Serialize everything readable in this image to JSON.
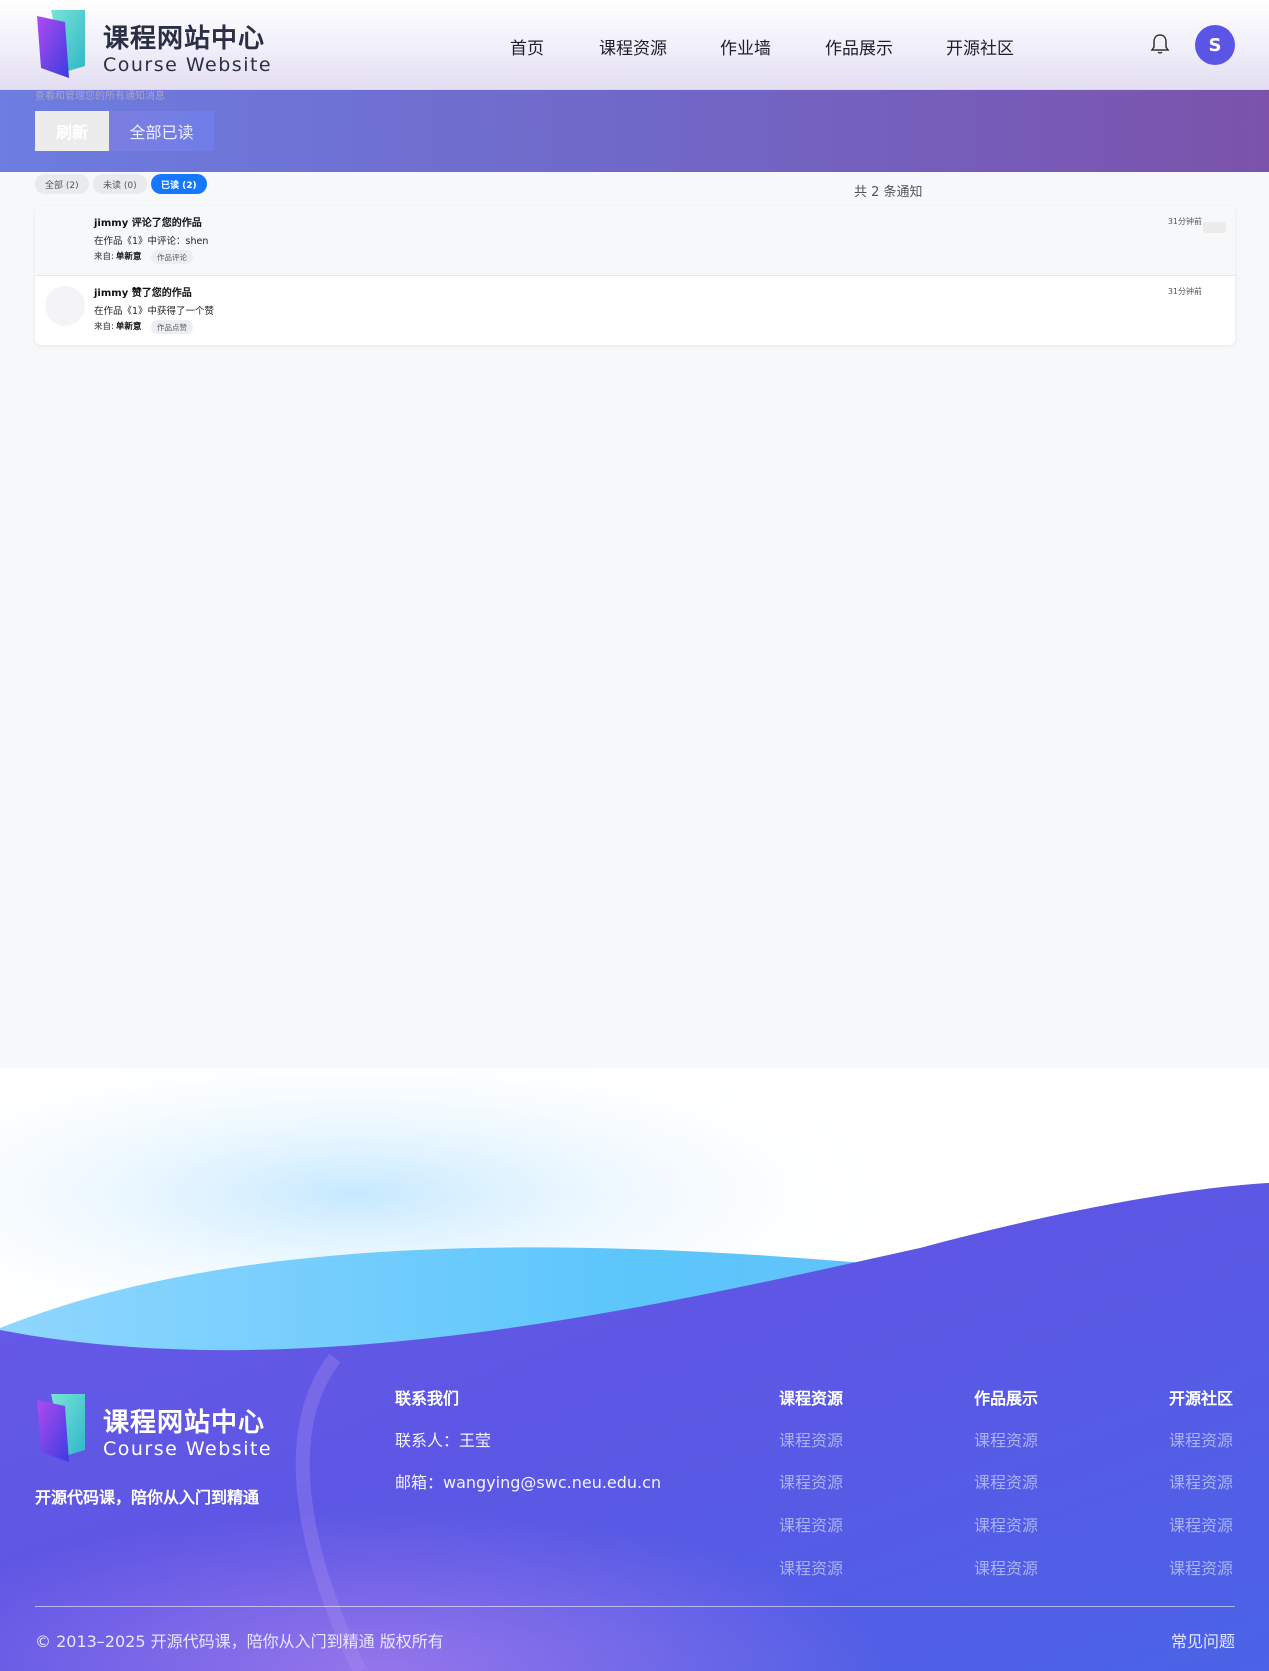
{
  "colors": {
    "accent": "#5b55e6",
    "primary_blue": "#1677ff",
    "banner_start": "#6d7de0",
    "banner_end": "#7b53ab",
    "footer_blue": "#4a63e7"
  },
  "brand": {
    "name_cn": "课程网站中心",
    "name_en": "Course Website",
    "logo_icon": "book-logo-icon"
  },
  "nav": {
    "items": [
      {
        "label": "首页"
      },
      {
        "label": "课程资源"
      },
      {
        "label": "作业墙"
      },
      {
        "label": "作品展示"
      },
      {
        "label": "开源社区"
      }
    ],
    "bell_icon": "bell-icon",
    "avatar_letter": "S"
  },
  "banner": {
    "subtitle": "查看和管理您的所有通知消息",
    "refresh_label": "刷新",
    "read_all_label": "全部已读"
  },
  "filters": {
    "all": "全部 (2)",
    "unread": "未读 (0)",
    "read": "已读 (2)",
    "active": "read"
  },
  "count_text": "共 2 条通知",
  "notifications": [
    {
      "title": "jimmy 评论了您的作品",
      "body": "在作品《1》中评论：shen",
      "from_label": "来自:",
      "from_name": "单新意",
      "tag": "作品评论",
      "time": "31分钟前"
    },
    {
      "title": "jimmy 赞了您的作品",
      "body": "在作品《1》中获得了一个赞",
      "from_label": "来自:",
      "from_name": "单新意",
      "tag": "作品点赞",
      "time": "31分钟前"
    }
  ],
  "footer": {
    "slogan": "开源代码课，陪你从入门到精通",
    "contact_heading": "联系我们",
    "contact_person": "联系人：王莹",
    "contact_email": "邮箱：wangying@swc.neu.edu.cn",
    "columns": [
      {
        "heading": "课程资源",
        "links": [
          "课程资源",
          "课程资源",
          "课程资源",
          "课程资源"
        ]
      },
      {
        "heading": "作品展示",
        "links": [
          "课程资源",
          "课程资源",
          "课程资源",
          "课程资源"
        ]
      },
      {
        "heading": "开源社区",
        "links": [
          "课程资源",
          "课程资源",
          "课程资源",
          "课程资源"
        ]
      }
    ],
    "copyright": "© 2013–2025 开源代码课，陪你从入门到精通 版权所有",
    "faq": "常见问题"
  }
}
